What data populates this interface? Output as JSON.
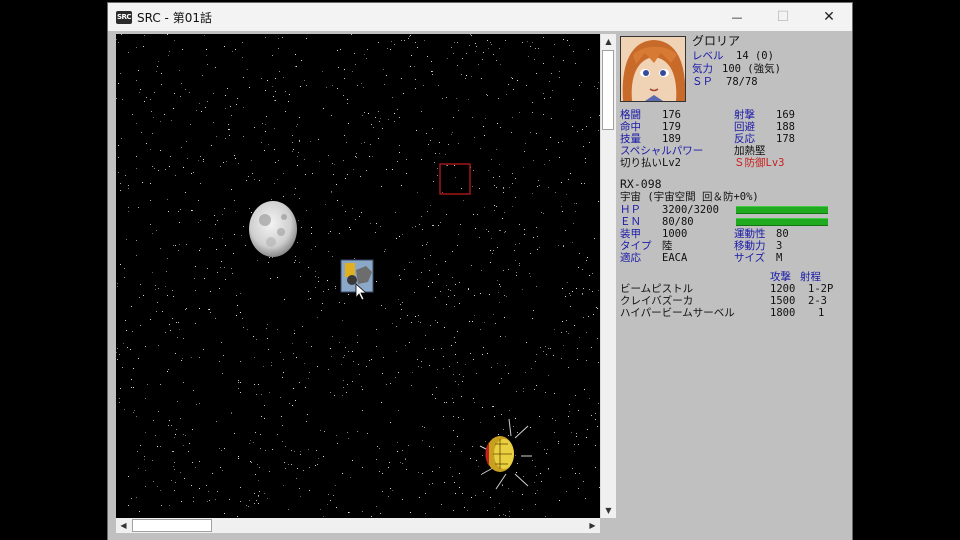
{
  "window": {
    "title": "SRC - 第01話",
    "icon_text": "SRC"
  },
  "window_controls": {
    "minimize": "—",
    "maximize": "☐",
    "close": "✕"
  },
  "scrollbars": {
    "up": "▲",
    "down": "▼",
    "left": "◀",
    "right": "▶"
  },
  "pilot": {
    "name": "グロリア",
    "level_label": "レベル",
    "level_value": "14 (0)",
    "morale_label": "気力",
    "morale_value": "100 (強気)",
    "sp_label": "ＳＰ",
    "sp_value": "78/78",
    "stats": [
      {
        "label": "格闘",
        "value": "176"
      },
      {
        "label": "射撃",
        "value": "169"
      },
      {
        "label": "命中",
        "value": "179"
      },
      {
        "label": "回避",
        "value": "188"
      },
      {
        "label": "技量",
        "value": "189"
      },
      {
        "label": "反応",
        "value": "178"
      }
    ],
    "special_power_label": "スペシャルパワー",
    "special_power_value": "加熱堅",
    "skill_1": "切り払いLv2",
    "skill_2": "Ｓ防御Lv3"
  },
  "unit": {
    "name": "RX-098",
    "terrain": "宇宙 (宇宙空間 回＆防+0%)",
    "hp_label": "ＨＰ",
    "hp_value": "3200/3200",
    "hp_fraction": 1.0,
    "en_label": "ＥＮ",
    "en_value": "80/80",
    "en_fraction": 1.0,
    "armor_label": "装甲",
    "armor_value": "1000",
    "mobility_label": "運動性",
    "mobility_value": "80",
    "type_label": "タイプ",
    "type_value": "陸",
    "move_label": "移動力",
    "move_value": "3",
    "adapt_label": "適応",
    "adapt_value": "EACA",
    "size_label": "サイズ",
    "size_value": "M",
    "colors": {
      "bar": "#1faa1f",
      "label": "#1a1aa8",
      "alert": "#c81e1e"
    }
  },
  "weapons": {
    "header_attack": "攻撃",
    "header_range": "射程",
    "items": [
      {
        "name": "ビームピストル",
        "attack": "1200",
        "range": "1-2P"
      },
      {
        "name": "クレイバズーカ",
        "attack": "1500",
        "range": "2-3"
      },
      {
        "name": "ハイパービームサーベル",
        "attack": "1800",
        "range": "1"
      }
    ]
  },
  "map": {
    "background": "starfield",
    "objects": [
      "moon",
      "player-unit",
      "enemy-unit",
      "cursor-frame"
    ],
    "cursor_color": "#c81e1e"
  }
}
